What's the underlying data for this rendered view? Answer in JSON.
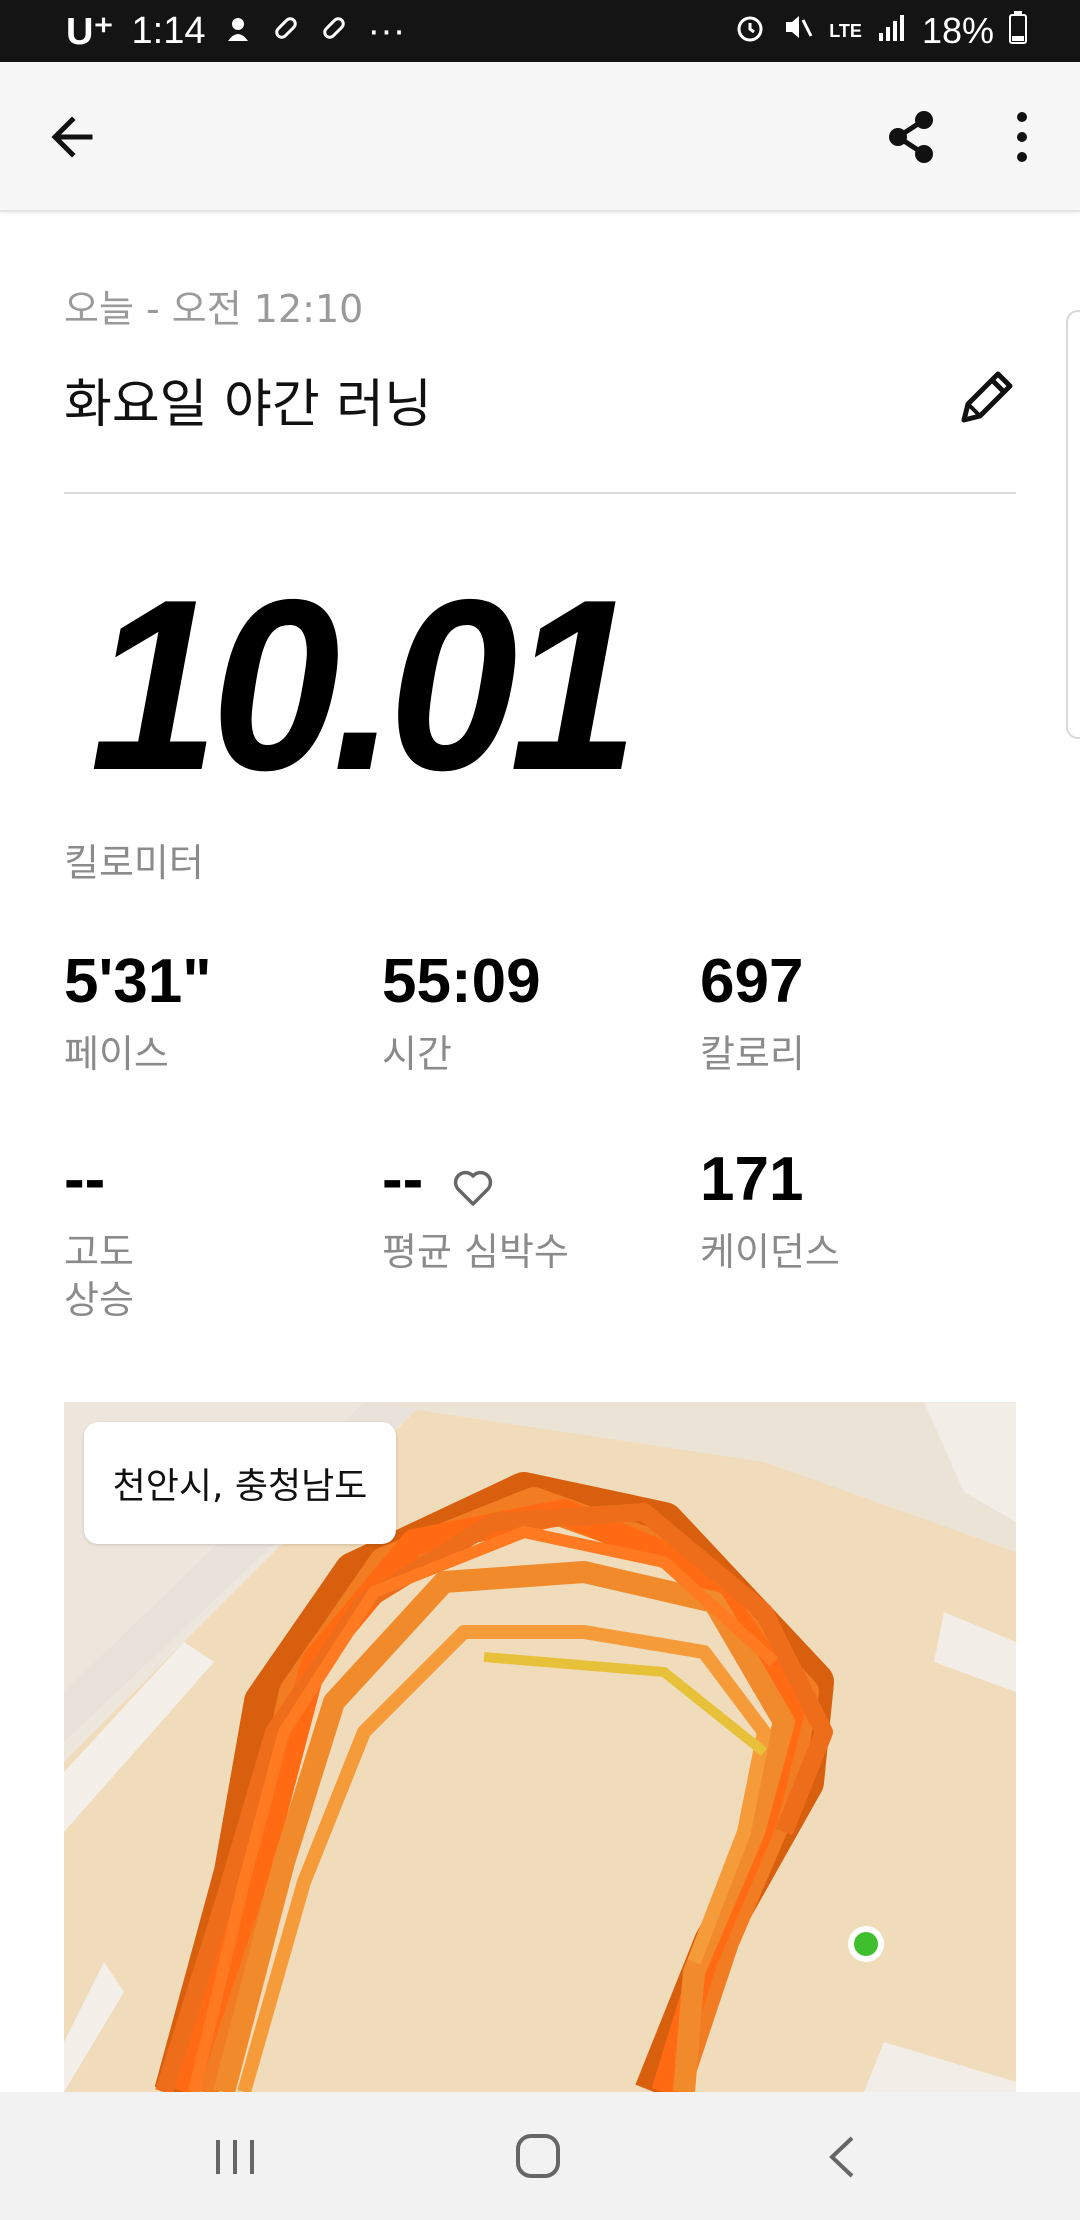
{
  "status_bar": {
    "carrier": "U⁺",
    "time": "1:14",
    "more": "···",
    "battery": "18%",
    "network": "LTE"
  },
  "header": {
    "icons": [
      "arrow-left-icon",
      "share-icon",
      "more-vertical-icon"
    ]
  },
  "activity": {
    "date": "오늘 - 오전 12:10",
    "title": "화요일 야간 러닝",
    "distance": "10.01",
    "distance_unit": "킬로미터"
  },
  "stats": [
    {
      "value": "5'31\"",
      "label": "페이스"
    },
    {
      "value": "55:09",
      "label": "시간"
    },
    {
      "value": "697",
      "label": "칼로리"
    },
    {
      "value": "--",
      "label_line1": "고도",
      "label_line2": "상승"
    },
    {
      "value": "--",
      "label": "평균 심박수"
    },
    {
      "value": "171",
      "label": "케이던스"
    }
  ],
  "map": {
    "location": "천안시, 충청남도",
    "route_color": "#f06a1a",
    "start_marker_color": "#3fbe2e"
  },
  "nav_bar": {
    "icons": [
      "recent-apps-icon",
      "home-icon",
      "back-icon"
    ]
  },
  "colors": {
    "accent": "#f06a1a",
    "text_primary": "#111111",
    "text_secondary": "#8b8b8b"
  }
}
